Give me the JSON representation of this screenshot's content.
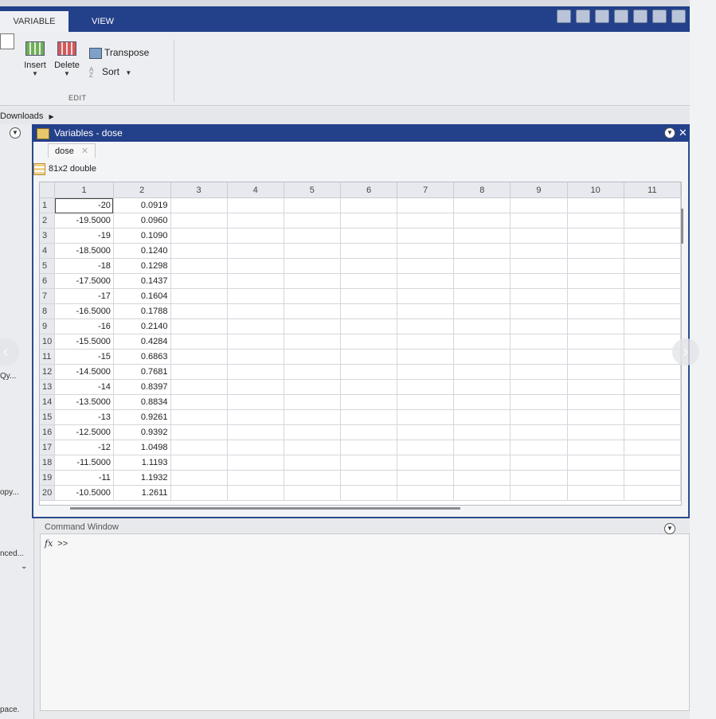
{
  "tabs": {
    "variable": "VARIABLE",
    "view": "VIEW"
  },
  "ribbon": {
    "insert": "Insert",
    "delete": "Delete",
    "transpose": "Transpose",
    "sort": "Sort",
    "group_edit": "EDIT"
  },
  "address": {
    "path": "Downloads"
  },
  "variables_window": {
    "title": "Variables - dose",
    "doc_tab": "dose",
    "size": "81x2 double"
  },
  "grid": {
    "columns": [
      "1",
      "2",
      "3",
      "4",
      "5",
      "6",
      "7",
      "8",
      "9",
      "10",
      "11"
    ],
    "rows": [
      [
        "1",
        "-20",
        "0.0919"
      ],
      [
        "2",
        "-19.5000",
        "0.0960"
      ],
      [
        "3",
        "-19",
        "0.1090"
      ],
      [
        "4",
        "-18.5000",
        "0.1240"
      ],
      [
        "5",
        "-18",
        "0.1298"
      ],
      [
        "6",
        "-17.5000",
        "0.1437"
      ],
      [
        "7",
        "-17",
        "0.1604"
      ],
      [
        "8",
        "-16.5000",
        "0.1788"
      ],
      [
        "9",
        "-16",
        "0.2140"
      ],
      [
        "10",
        "-15.5000",
        "0.4284"
      ],
      [
        "11",
        "-15",
        "0.6863"
      ],
      [
        "12",
        "-14.5000",
        "0.7681"
      ],
      [
        "13",
        "-14",
        "0.8397"
      ],
      [
        "14",
        "-13.5000",
        "0.8834"
      ],
      [
        "15",
        "-13",
        "0.9261"
      ],
      [
        "16",
        "-12.5000",
        "0.9392"
      ],
      [
        "17",
        "-12",
        "1.0498"
      ],
      [
        "18",
        "-11.5000",
        "1.1193"
      ],
      [
        "19",
        "-11",
        "1.1932"
      ],
      [
        "20",
        "-10.5000",
        "1.2611"
      ]
    ]
  },
  "command_window": {
    "title": "Command Window",
    "prompt": ">>"
  },
  "left_panel": {
    "item_qy": "Qy...",
    "item_copy": "opy...",
    "item_adv": "nced...",
    "item_space": "pace."
  },
  "icons": [
    "save-icon",
    "cut-icon",
    "copy-icon",
    "paste-icon",
    "undo-icon",
    "redo-icon",
    "window-icon",
    "transpose-icon",
    "sort-icon",
    "dropdown-icon",
    "close-icon"
  ]
}
